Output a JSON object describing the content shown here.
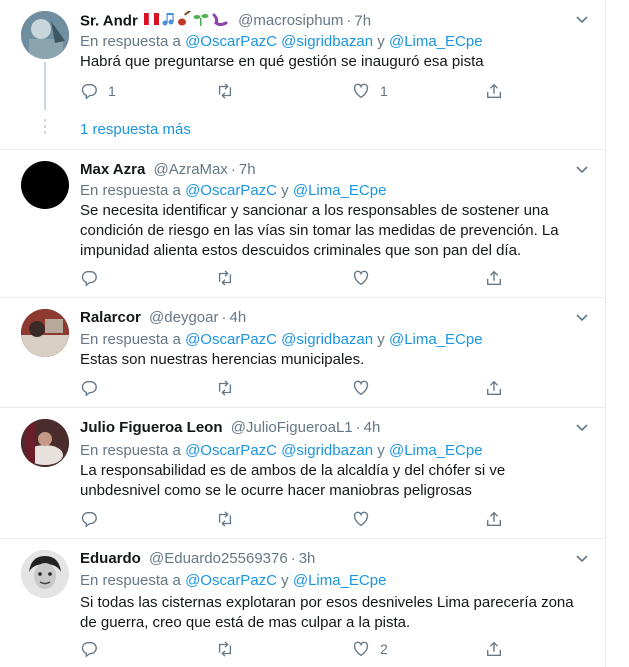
{
  "tweets": [
    {
      "name": "Sr. Andr",
      "emojis": [
        "peru-flag-icon",
        "music-notes-icon",
        "guitar-icon",
        "seedling-icon",
        "worm-icon"
      ],
      "handle": "@macrosiphum",
      "separator": "·",
      "time": "7h",
      "reply_prefix": "En respuesta a",
      "mentions": [
        "@OscarPazC",
        "@sigridbazan"
      ],
      "conjunction": "y",
      "last_mention": "@Lima_ECpe",
      "text": "Habrá que preguntarse en qué gestión se inauguró esa pista",
      "reply_count": "1",
      "retweet_count": "",
      "like_count": "1"
    },
    {
      "name": "Max Azra",
      "handle": "@AzraMax",
      "separator": "·",
      "time": "7h",
      "reply_prefix": "En respuesta a",
      "mentions": [
        "@OscarPazC"
      ],
      "conjunction": "y",
      "last_mention": "@Lima_ECpe",
      "text": "Se necesita identificar y sancionar a los responsables de sostener una condición de riesgo en las vías sin tomar las medidas de prevención. La impunidad alienta estos descuidos criminales que son pan del día.",
      "reply_count": "",
      "retweet_count": "",
      "like_count": ""
    },
    {
      "name": "Ralarcor",
      "handle": "@deygoar",
      "separator": "·",
      "time": "4h",
      "reply_prefix": "En respuesta a",
      "mentions": [
        "@OscarPazC",
        "@sigridbazan"
      ],
      "conjunction": "y",
      "last_mention": "@Lima_ECpe",
      "text": "Estas son nuestras herencias municipales.",
      "reply_count": "",
      "retweet_count": "",
      "like_count": ""
    },
    {
      "name": "Julio Figueroa Leon",
      "handle": "@JulioFigueroaL1",
      "separator": "·",
      "time": "4h",
      "reply_prefix": "En respuesta a",
      "mentions": [
        "@OscarPazC",
        "@sigridbazan"
      ],
      "conjunction": "y",
      "last_mention": "@Lima_ECpe",
      "text": "La responsabilidad es de ambos de la alcaldía y del chófer si ve unbdesnivel como se le ocurre hacer maniobras peligrosas",
      "reply_count": "",
      "retweet_count": "",
      "like_count": ""
    },
    {
      "name": "Eduardo",
      "handle": "@Eduardo25569376",
      "separator": "·",
      "time": "3h",
      "reply_prefix": "En respuesta a",
      "mentions": [
        "@OscarPazC"
      ],
      "conjunction": "y",
      "last_mention": "@Lima_ECpe",
      "text": "Si todas las cisternas explotaran por esos desniveles Lima parecería zona de guerra, creo que está de mas culpar a la pista.",
      "reply_count": "",
      "retweet_count": "",
      "like_count": "2"
    }
  ],
  "more_replies": "1 respuesta más",
  "colors": {
    "link": "#1b95e0",
    "muted": "#657786",
    "border": "#e6ecf0",
    "text": "#14171a"
  }
}
